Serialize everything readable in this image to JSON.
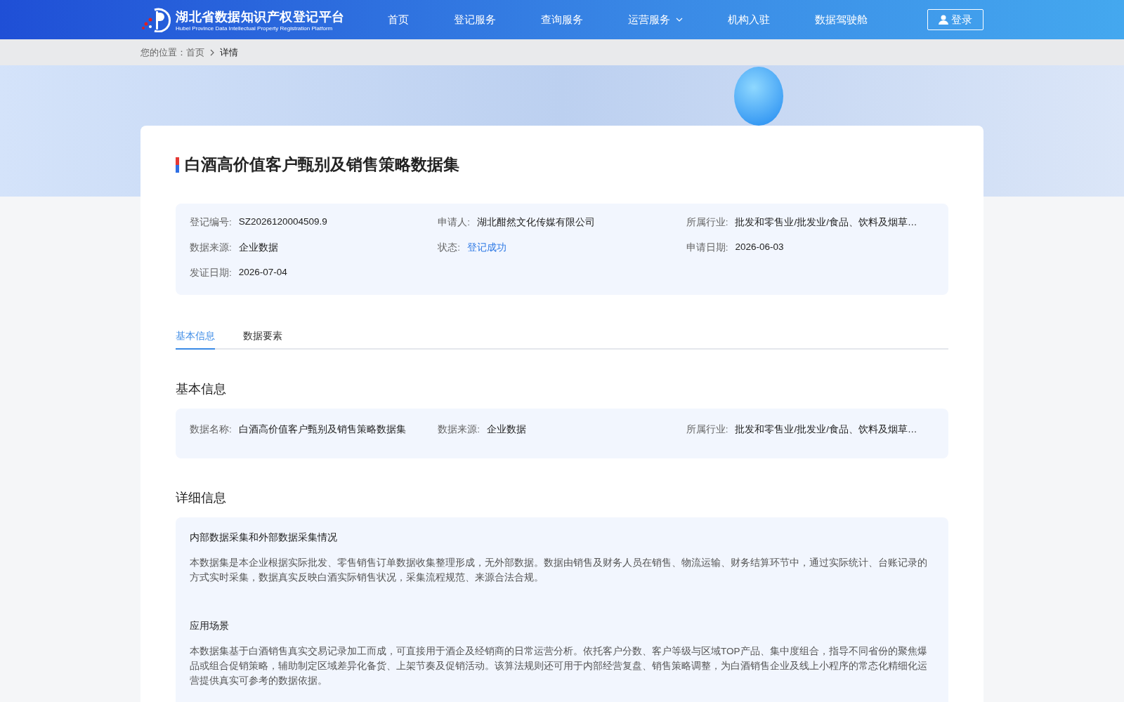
{
  "header": {
    "logo_title": "湖北省数据知识产权登记平台",
    "logo_subtitle": "Hubei Province Data Intellectual Property Registration Platform",
    "nav": [
      {
        "label": "首页",
        "dropdown": false
      },
      {
        "label": "登记服务",
        "dropdown": false
      },
      {
        "label": "查询服务",
        "dropdown": false
      },
      {
        "label": "运营服务",
        "dropdown": true
      },
      {
        "label": "机构入驻",
        "dropdown": false
      },
      {
        "label": "数据驾驶舱",
        "dropdown": false
      }
    ],
    "login": "登录"
  },
  "breadcrumb": {
    "prefix": "您的位置：",
    "items": [
      "首页",
      "详情"
    ]
  },
  "title": "白酒高价值客户甄别及销售策略数据集",
  "summary": [
    {
      "label": "登记编号:",
      "value": "SZ2026120004509.9",
      "kind": "text"
    },
    {
      "label": "申请人:",
      "value": "湖北酣然文化传媒有限公司",
      "kind": "text"
    },
    {
      "label": "所属行业:",
      "value": "批发和零售业/批发业/食品、饮料及烟草…",
      "kind": "text"
    },
    {
      "label": "数据来源:",
      "value": "企业数据",
      "kind": "text"
    },
    {
      "label": "状态:",
      "value": "登记成功",
      "kind": "status"
    },
    {
      "label": "申请日期:",
      "value": "2026-06-03",
      "kind": "text"
    },
    {
      "label": "发证日期:",
      "value": "2026-07-04",
      "kind": "text"
    }
  ],
  "tabs": [
    {
      "label": "基本信息",
      "selected": true
    },
    {
      "label": "数据要素",
      "selected": false
    }
  ],
  "basic": {
    "heading": "基本信息",
    "fields": [
      {
        "label": "数据名称:",
        "value": "白酒高价值客户甄别及销售策略数据集"
      },
      {
        "label": "数据来源:",
        "value": "企业数据"
      },
      {
        "label": "所属行业:",
        "value": "批发和零售业/批发业/食品、饮料及烟草…"
      }
    ]
  },
  "detail": {
    "heading": "详细信息",
    "sections": [
      {
        "title": "内部数据采集和外部数据采集情况",
        "text": "本数据集是本企业根据实际批发、零售销售订单数据收集整理形成，无外部数据。数据由销售及财务人员在销售、物流运输、财务结算环节中，通过实际统计、台账记录的方式实时采集，数据真实反映白酒实际销售状况，采集流程规范、来源合法合规。"
      },
      {
        "title": "应用场景",
        "text": "本数据集基于白酒销售真实交易记录加工而成，可直接用于酒企及经销商的日常运营分析。依托客户分数、客户等级与区域TOP产品、集中度组合，指导不同省份的聚焦爆品或组合促销策略，辅助制定区域差异化备货、上架节奏及促销活动。该算法规则还可用于内部经营复盘、销售策略调整，为白酒销售企业及线上小程序的常态化精细化运营提供真实可参考的数据依据。"
      }
    ]
  }
}
